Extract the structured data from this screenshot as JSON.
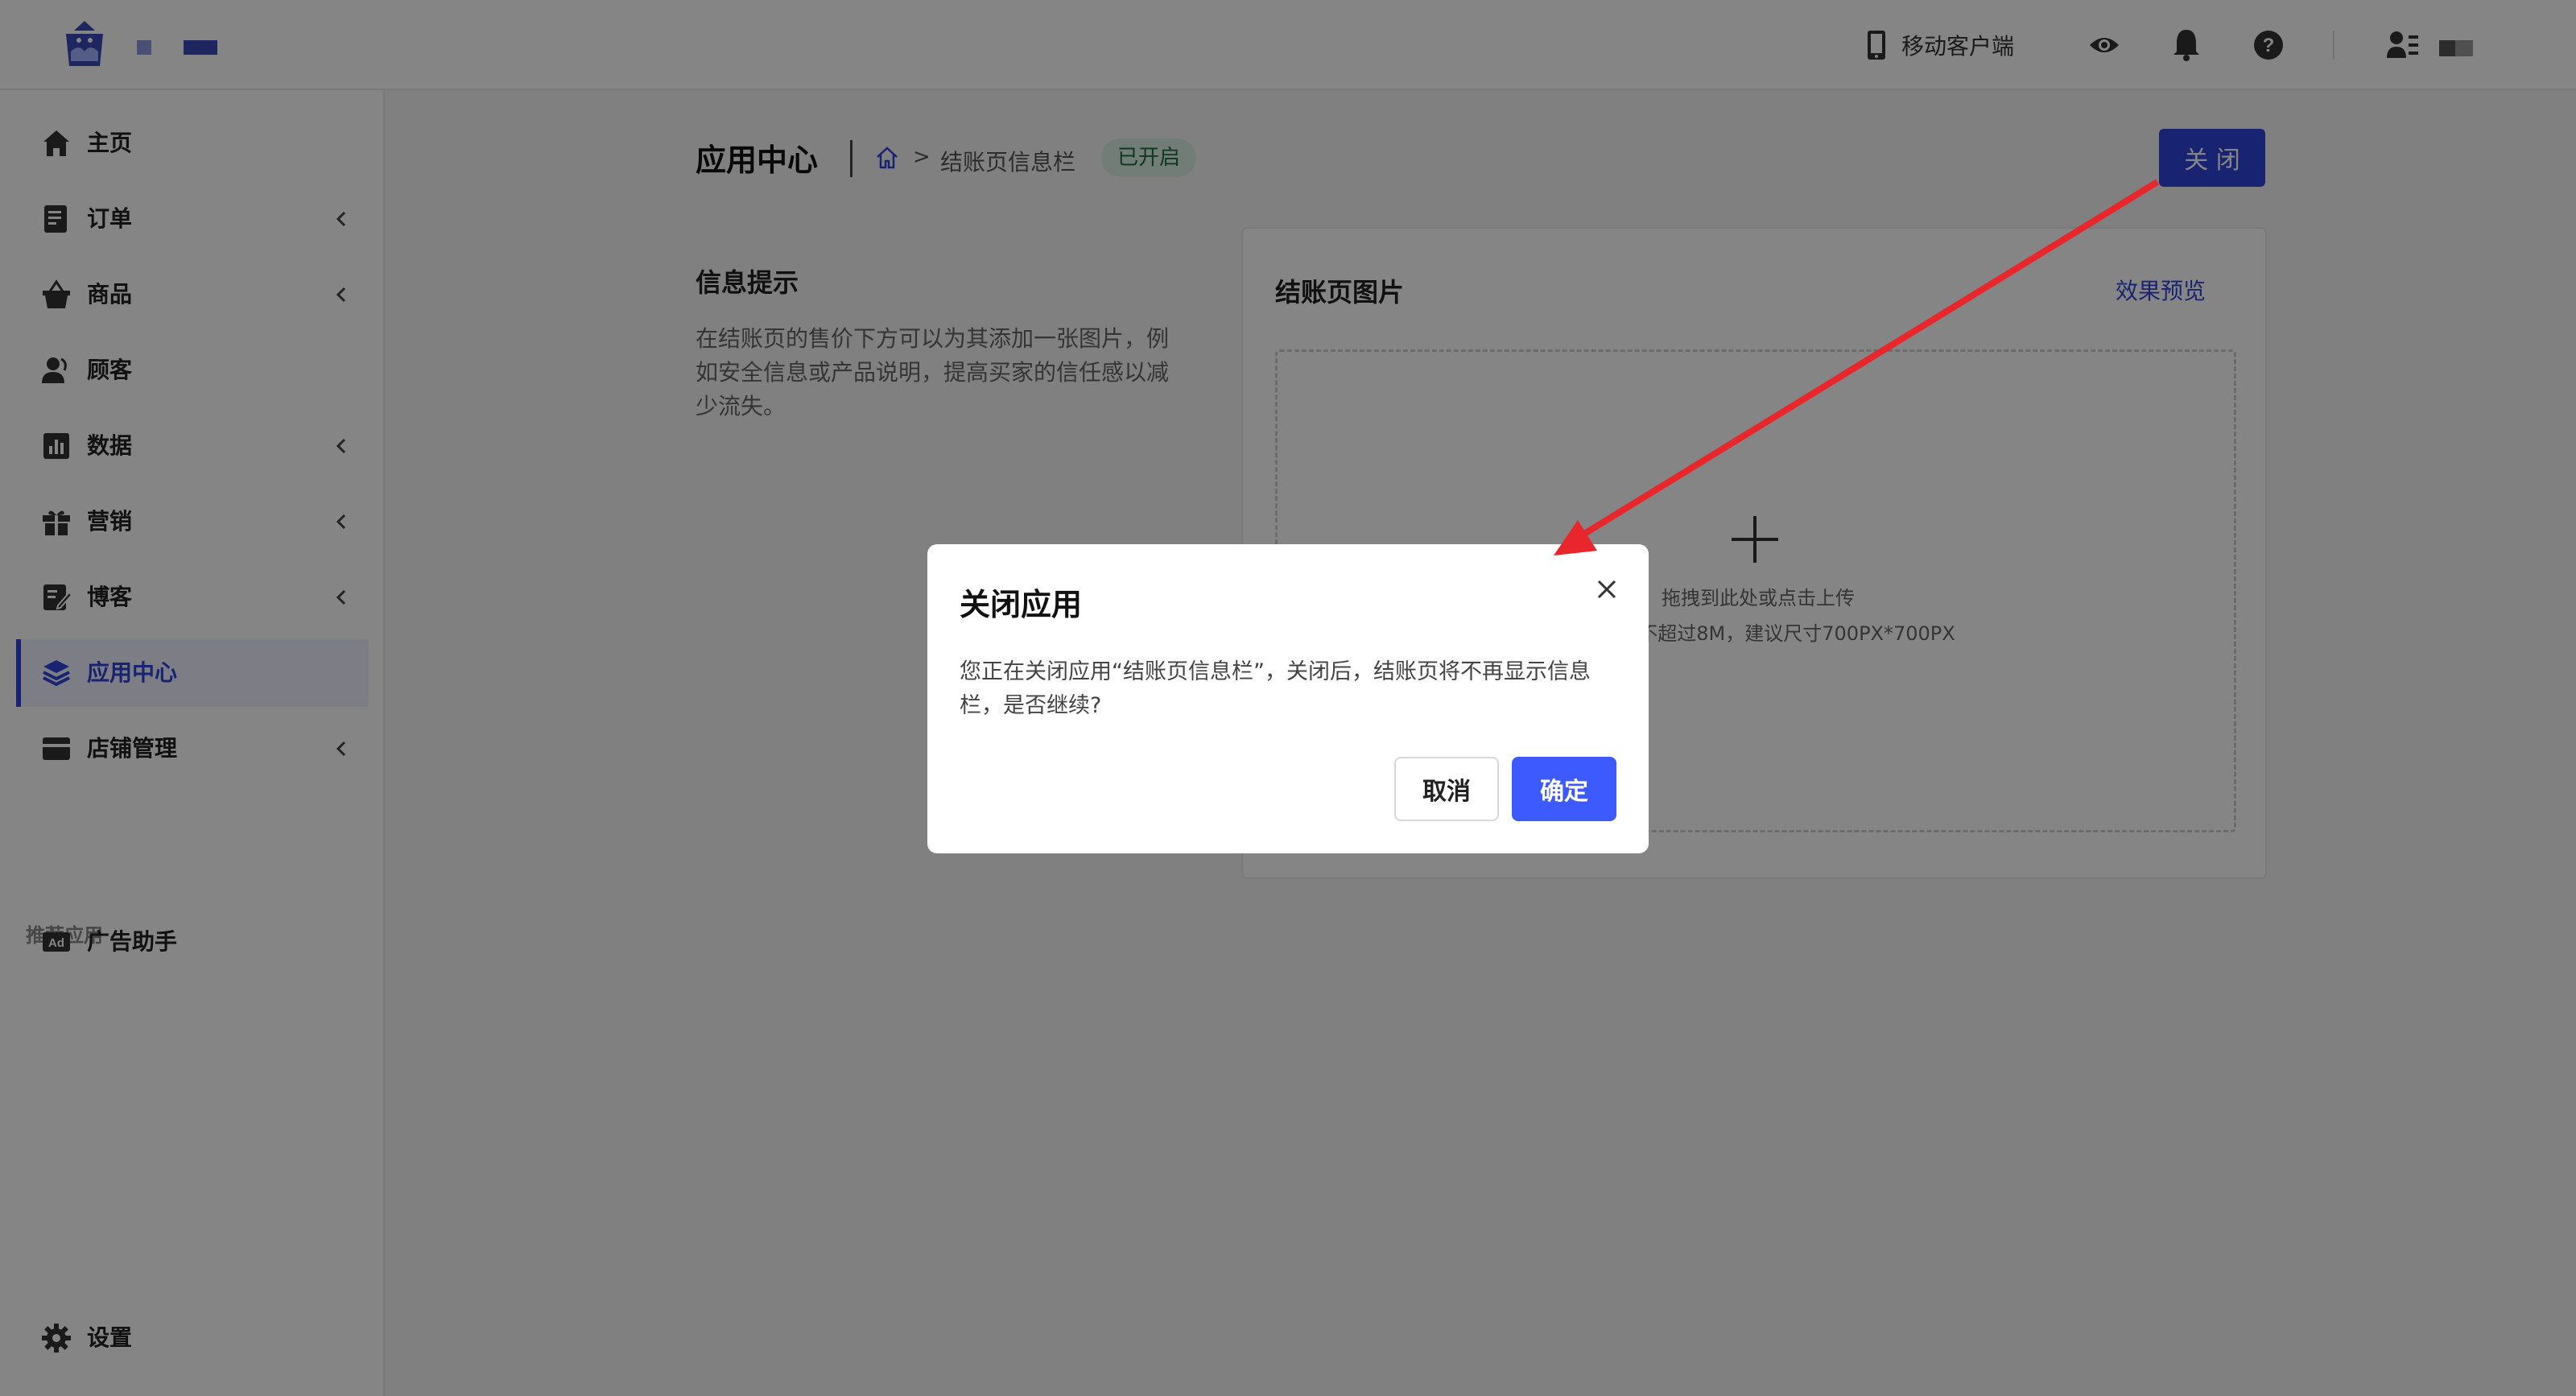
{
  "header": {
    "mobile_client": "移动客户端",
    "icons": [
      "mobile-icon",
      "eye-icon",
      "bell-icon",
      "help-icon",
      "user-list-icon"
    ]
  },
  "sidebar": {
    "items": [
      {
        "label": "主页",
        "icon": "home-icon",
        "chevron": false
      },
      {
        "label": "订单",
        "icon": "order-icon",
        "chevron": true
      },
      {
        "label": "商品",
        "icon": "basket-icon",
        "chevron": true
      },
      {
        "label": "顾客",
        "icon": "customer-icon",
        "chevron": false
      },
      {
        "label": "数据",
        "icon": "chart-icon",
        "chevron": true
      },
      {
        "label": "营销",
        "icon": "gift-icon",
        "chevron": true
      },
      {
        "label": "博客",
        "icon": "blog-icon",
        "chevron": true
      },
      {
        "label": "应用中心",
        "icon": "layers-icon",
        "chevron": false,
        "active": true
      },
      {
        "label": "店铺管理",
        "icon": "store-icon",
        "chevron": true
      }
    ],
    "section_label": "推荐应用",
    "recommended": [
      {
        "label": "广告助手",
        "icon": "ad-icon"
      }
    ],
    "footer": {
      "label": "设置",
      "icon": "gear-icon"
    }
  },
  "page": {
    "title": "应用中心",
    "breadcrumb_sep": ">",
    "breadcrumb_current": "结账页信息栏",
    "status": "已开启",
    "close_button": "关 闭"
  },
  "info": {
    "title": "信息提示",
    "description": "在结账页的售价下方可以为其添加一张图片，例如安全信息或产品说明，提高买家的信任感以减少流失。"
  },
  "card": {
    "title": "结账页图片",
    "preview_link": "效果预览",
    "upload_hint": "拖拽到此处或点击上传",
    "upload_limit": "图片大小不超过8M，建议尺寸700PX*700PX"
  },
  "dialog": {
    "title": "关闭应用",
    "message": "您正在关闭应用“结账页信息栏”，关闭后，结账页将不再显示信息栏，是否继续?",
    "cancel": "取消",
    "confirm": "确定"
  },
  "colors": {
    "accent": "#2f46d8",
    "confirm": "#3d5afe",
    "status_bg": "#d9efe2",
    "annotation_arrow": "#e8262b"
  }
}
